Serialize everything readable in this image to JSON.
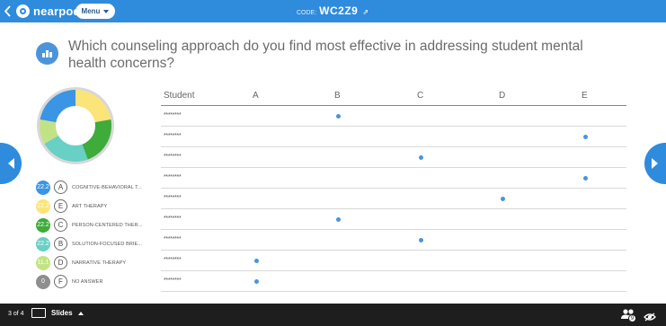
{
  "app": {
    "brand": "nearpod",
    "accent": "#2f8bdc"
  },
  "topbar": {
    "menu_label": "Menu",
    "code_label": "CODE:",
    "code_value": "WC2Z9",
    "code_icon": "external-link-icon"
  },
  "question": {
    "icon": "bar-chart-icon",
    "text": "Which counseling approach do you find most effective in addressing student mental health concerns?"
  },
  "legend": [
    {
      "count": "22.2",
      "letter": "A",
      "label": "COGNITIVE-BEHAVIORAL T...",
      "color": "#3a95e4"
    },
    {
      "count": "22.2",
      "letter": "E",
      "label": "ART THERAPY",
      "color": "#fbe47a"
    },
    {
      "count": "22.2",
      "letter": "C",
      "label": "PERSON-CENTERED THER...",
      "color": "#3eab3b"
    },
    {
      "count": "22.2",
      "letter": "B",
      "label": "SOLUTION-FOCUSED BRIE...",
      "color": "#68d0c5"
    },
    {
      "count": "11.1",
      "letter": "D",
      "label": "NARRATIVE THERAPY",
      "color": "#c2e385"
    },
    {
      "count": "0",
      "letter": "F",
      "label": "NO ANSWER",
      "color": "#8e8e8e"
    }
  ],
  "table": {
    "headers": [
      "Student",
      "A",
      "B",
      "C",
      "D",
      "E"
    ],
    "rows": [
      {
        "student": "********",
        "answer": "B"
      },
      {
        "student": "********",
        "answer": "E"
      },
      {
        "student": "********",
        "answer": "C"
      },
      {
        "student": "********",
        "answer": "E"
      },
      {
        "student": "********",
        "answer": "D"
      },
      {
        "student": "********",
        "answer": "B"
      },
      {
        "student": "********",
        "answer": "C"
      },
      {
        "student": "********",
        "answer": "A"
      },
      {
        "student": "********",
        "answer": "A"
      }
    ]
  },
  "bottombar": {
    "page_indicator": "3 of 4",
    "slides_label": "Slides",
    "students_count": "9"
  }
}
